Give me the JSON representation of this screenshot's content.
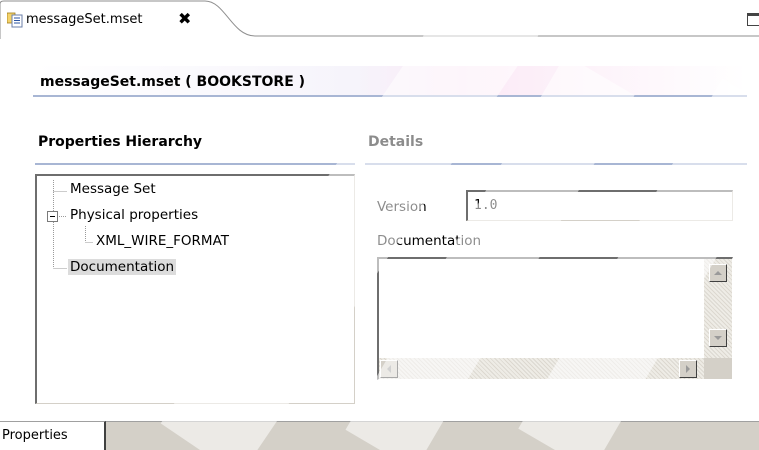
{
  "editor": {
    "tab_label": "messageSet.mset",
    "close_glyph": "✖",
    "icon": "message-set-file-icon"
  },
  "header": {
    "title": "messageSet.mset ( BOOKSTORE )"
  },
  "hierarchy": {
    "title": "Properties Hierarchy",
    "items": [
      {
        "label": "Message Set"
      },
      {
        "label": "Physical properties"
      },
      {
        "label": "XML_WIRE_FORMAT"
      },
      {
        "label": "Documentation"
      }
    ]
  },
  "details": {
    "title": "Details",
    "version_label": "Version",
    "version_value": "1.0",
    "documentation_label": "Documentation",
    "documentation_value": ""
  },
  "bottom": {
    "tab_label": "Properties"
  },
  "colors": {
    "section_rule": "#a8b6d4",
    "selection": "#dcdcdc",
    "panel": "#d4d0c8"
  }
}
